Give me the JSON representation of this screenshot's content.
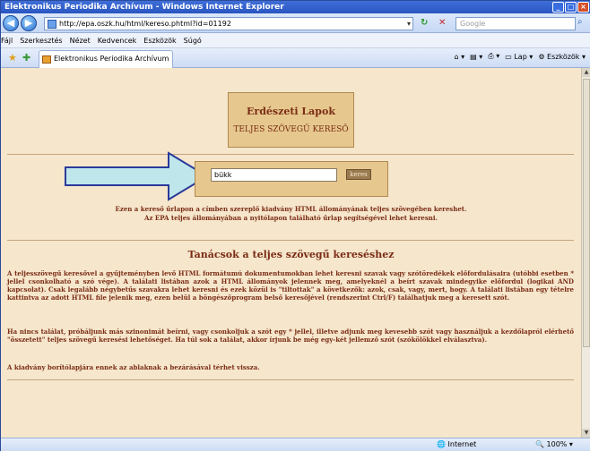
{
  "window": {
    "title": "Elektronikus Periodika Archívum - Windows Internet Explorer"
  },
  "address": {
    "url": "http://epa.oszk.hu/html/kereso.phtml?id=01192",
    "search_placeholder": "Google"
  },
  "menu": [
    "Fájl",
    "Szerkesztés",
    "Nézet",
    "Kedvencek",
    "Eszközök",
    "Súgó"
  ],
  "tab": {
    "label": "Elektronikus Periodika Archívum"
  },
  "commands": {
    "page": "Lap",
    "tools": "Eszközök"
  },
  "page": {
    "title_line1": "Erdészeti Lapok",
    "title_line2": "TELJES SZÖVEGŰ KERESŐ",
    "search_value": "bükk",
    "search_button": "keres",
    "intro_line1": "Ezen a kereső űrlapon a címben szereplő kiadvány HTML állományának teljes szövegében kereshet.",
    "intro_line2": "Az EPA teljes állományában a nyitólapon található űrlap segítségével lehet keresni.",
    "tips_heading": "Tanácsok a teljes szövegű kereséshez",
    "para1": "A teljesszövegű keresővel a gyűjteményben levő HTML formátumú dokumentumokban lehet keresni szavak vagy szótöredékek előfordulásaira (utóbbi esetben * jellel csonkolható a szó vége). A találati listában azok a HTML állományok jelennek meg, amelyeknél a beírt szavak mindegyike előfordul (logikai AND kapcsolat). Csak legalább négybetűs szavakra lehet keresni és ezek közül is \"tiltottak\" a következők: azok, csak, vagy, mert, hogy. A találati listában egy tételre kattintva az adott HTML file jelenik meg, ezen belül a böngészőprogram belső keresőjével (rendszerint Ctrl/F) találhatjuk meg a keresett szót.",
    "para2": "Ha nincs találat, próbáljunk más szinonimát beírni, vagy csonkoljuk a szót egy * jellel, illetve adjunk meg kevesebb szót vagy használjuk a kezdőlapról elérhető \"összetett\" teljes szövegű keresési lehetőséget. Ha túl sok a találat, akkor írjunk be még egy-két jellemző szót (szókölökkel elválasztva).",
    "para3": "A kiadvány borítólapjára ennek az ablaknak a bezárásával térhet vissza."
  },
  "status": {
    "zone": "Internet",
    "zoom": "100%"
  }
}
